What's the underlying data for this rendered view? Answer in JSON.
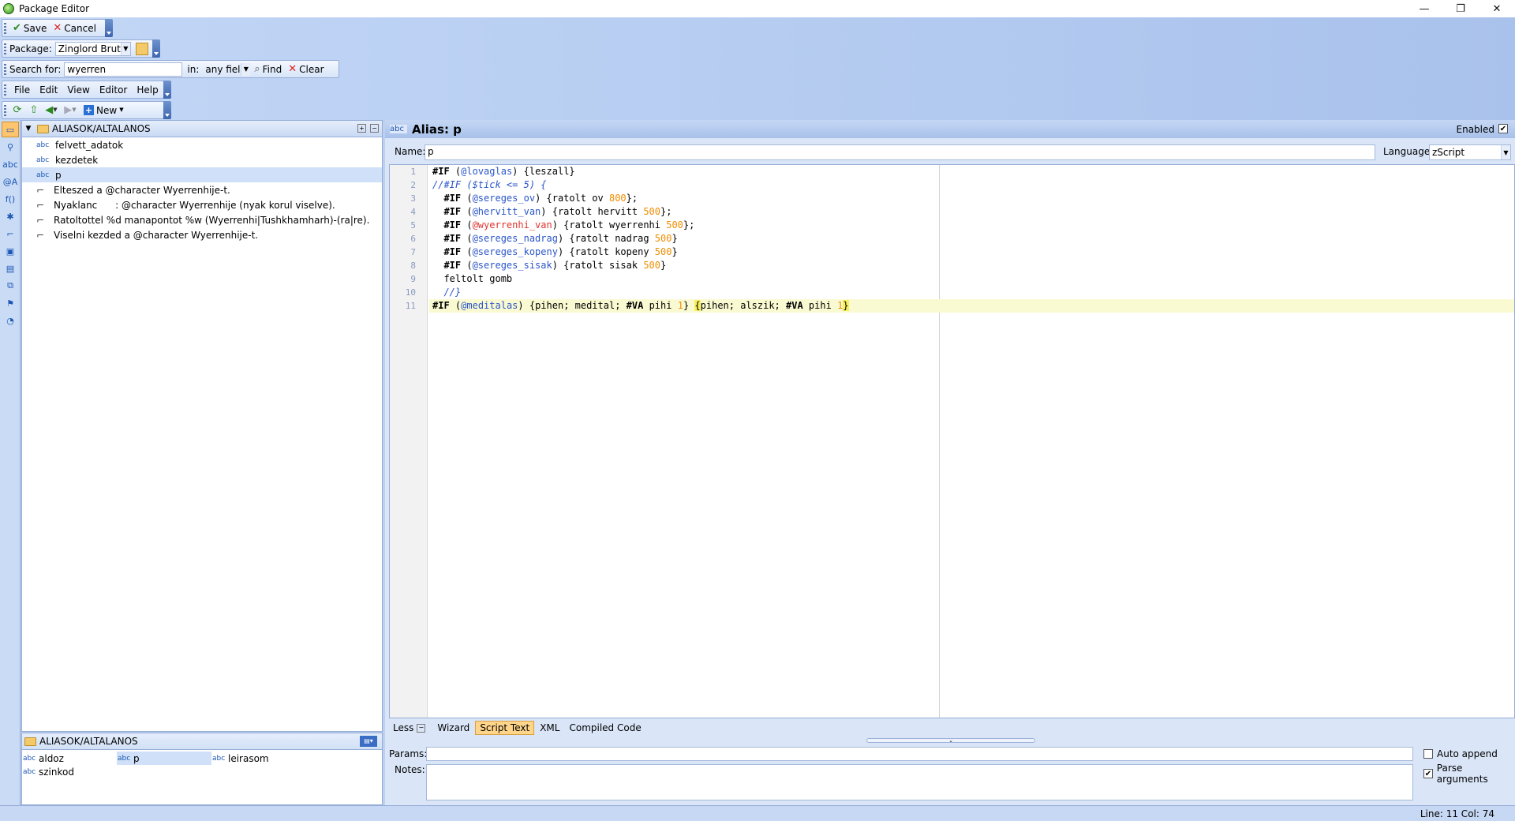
{
  "window": {
    "title": "Package Editor",
    "controls": [
      "—",
      "❐",
      "✕"
    ]
  },
  "toolbar_main": {
    "save_label": "Save",
    "cancel_label": "Cancel"
  },
  "toolbar_package": {
    "label": "Package:",
    "value": "Zinglord Brutali"
  },
  "toolbar_search": {
    "label": "Search for:",
    "value": "wyerren",
    "in_label": "in:",
    "field_value": "any field",
    "find_label": "Find",
    "clear_label": "Clear"
  },
  "menu": {
    "file": "File",
    "edit": "Edit",
    "view": "View",
    "editor": "Editor",
    "help": "Help"
  },
  "toolbar_nav": {
    "new_label": "New"
  },
  "tree": {
    "path": "ALIASOK/ALTALANOS",
    "items": [
      {
        "icon": "abc",
        "label": "felvett_adatok"
      },
      {
        "icon": "abc",
        "label": "kezdetek"
      },
      {
        "icon": "abc",
        "label": "p"
      },
      {
        "icon": "trigger",
        "label": "Elteszed a @character Wyerrenhije-t."
      },
      {
        "icon": "trigger",
        "label": "Nyaklanc      : @character Wyerrenhije (nyak korul viselve)."
      },
      {
        "icon": "trigger",
        "label": "Ratoltottel %d manapontot %w (Wyerrenhi|Tushkhamharh)-(ra|re)."
      },
      {
        "icon": "trigger",
        "label": "Viselni kezded a @character Wyerrenhije-t."
      }
    ]
  },
  "bottom_panel": {
    "path": "ALIASOK/ALTALANOS",
    "items": [
      {
        "icon": "abc",
        "label": "aldoz"
      },
      {
        "icon": "abc",
        "label": "p"
      },
      {
        "icon": "abc",
        "label": "leirasom"
      },
      {
        "icon": "abc",
        "label": "szinkod"
      }
    ]
  },
  "alias": {
    "header_icon": "abc",
    "title": "Alias: p",
    "enabled_label": "Enabled",
    "name_label": "Name:",
    "name_value": "p",
    "language_label": "Language:",
    "language_value": "zScript"
  },
  "code": {
    "line_numbers": [
      "1",
      "2",
      "3",
      "4",
      "5",
      "6",
      "7",
      "8",
      "9",
      "10",
      "11"
    ],
    "l1": {
      "a": "#IF",
      "b": " (",
      "c": "@lovaglas",
      "d": ") {leszall}"
    },
    "l2": "//#IF ($tick <= 5) {",
    "l3": {
      "a": "  #IF",
      "b": " (",
      "c": "@sereges_ov",
      "d": ") {ratolt ov ",
      "e": "800",
      "f": "};"
    },
    "l4": {
      "a": "  #IF",
      "b": " (",
      "c": "@hervitt_van",
      "d": ") {ratolt hervitt ",
      "e": "500",
      "f": "};"
    },
    "l5": {
      "a": "  #IF",
      "b": " (",
      "c": "@wyerrenhi_van",
      "d": ") {ratolt wyerrenhi ",
      "e": "500",
      "f": "};"
    },
    "l6": {
      "a": "  #IF",
      "b": " (",
      "c": "@sereges_nadrag",
      "d": ") {ratolt nadrag ",
      "e": "500",
      "f": "}"
    },
    "l7": {
      "a": "  #IF",
      "b": " (",
      "c": "@sereges_kopeny",
      "d": ") {ratolt kopeny ",
      "e": "500",
      "f": "}"
    },
    "l8": {
      "a": "  #IF",
      "b": " (",
      "c": "@sereges_sisak",
      "d": ") {ratolt sisak ",
      "e": "500",
      "f": "}"
    },
    "l9": "  feltolt gomb",
    "l10": "  //}",
    "l11": {
      "a": "#IF",
      "b": " (",
      "c": "@meditalas",
      "d": ") {pihen; medital; ",
      "e": "#VA",
      "f": " pihi ",
      "g": "1",
      "h": "} ",
      "i": "{",
      "j": "pihen; alszik; ",
      "k": "#VA",
      "l": " pihi ",
      "m": "1",
      "n": "}"
    }
  },
  "tabs": {
    "less": "Less",
    "wizard": "Wizard",
    "script_text": "Script Text",
    "xml": "XML",
    "compiled": "Compiled Code"
  },
  "params": {
    "label": "Params:",
    "value": "",
    "auto_append": "Auto append",
    "parse_args": "Parse arguments"
  },
  "notes": {
    "label": "Notes:",
    "value": ""
  },
  "status": {
    "position": "Line: 11 Col: 74"
  },
  "colors": {
    "accent": "#2b56c9",
    "highlight": "#f8f15c",
    "number": "#f08d00",
    "error_var": "#e0322c"
  }
}
